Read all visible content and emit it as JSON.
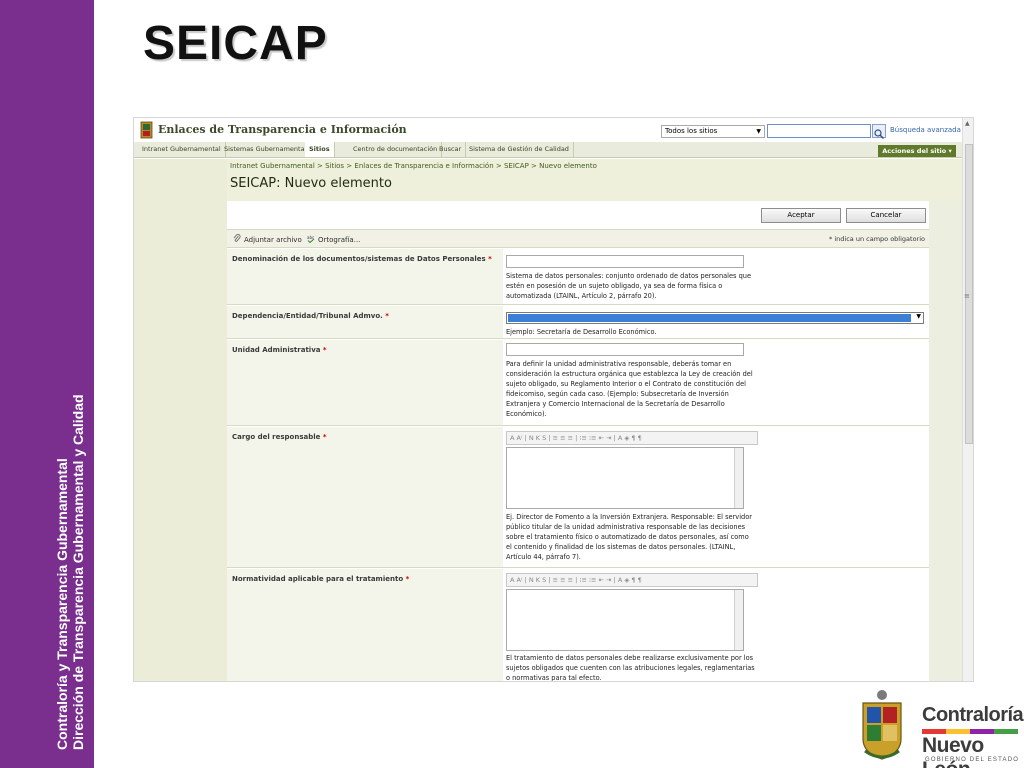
{
  "slide": {
    "title": "SEICAP",
    "side_line1": "Contraloría  y Transparencia Gubernamental",
    "side_line2": "Dirección de Transparencia Gubernamental y Calidad",
    "logo_text1": "Contraloría",
    "logo_text2": "Nuevo León",
    "logo_text3": "GOBIERNO DEL ESTADO",
    "band_color": "#7a2f8e"
  },
  "site": {
    "title": "Enlaces de Transparencia e Información",
    "scope": "Todos los sitios",
    "search_value": "",
    "advanced_search": "Búsqueda avanzada",
    "nav": [
      "Intranet Gubernamental",
      "Sistemas Gubernamentales ▾",
      "Sitios",
      "Centro de documentación",
      "Buscar",
      "Sistema de Gestión de Calidad"
    ],
    "site_actions": "Acciones del sitio ▾"
  },
  "page": {
    "breadcrumb": "Intranet Gubernamental > Sitios > Enlaces de Transparencia e Información > SEICAP > Nuevo elemento",
    "title": "SEICAP: Nuevo elemento"
  },
  "form": {
    "accept": "Aceptar",
    "cancel": "Cancelar",
    "attach": "Adjuntar archivo",
    "spelling": "Ortografía...",
    "required_note": "* indica un campo obligatorio",
    "rte_toolbar": "A  A⁽  |  N  K  S  |  ≡  ≡  ≡  |  ⁝≡  ⁝≡  ⇤  ⇥  |  A  ◈  ¶  ¶",
    "fields": [
      {
        "label": "Denominación de los documentos/sistemas de Datos Personales",
        "value": "",
        "help": "Sistema de datos personales: conjunto ordenado de datos personales que estén en posesión de un sujeto obligado, ya sea de forma física o automatizada (LTAINL, Artículo 2, párrafo 20)."
      },
      {
        "label": "Dependencia/Entidad/Tribunal Admvo.",
        "value": "",
        "help": "Ejemplo: Secretaría de Desarrollo Económico."
      },
      {
        "label": "Unidad Administrativa",
        "value": "",
        "help": "Para definir la unidad administrativa responsable, deberás tomar en consideración la estructura orgánica que establezca la Ley de creación del sujeto obligado, su Reglamento Interior o  el Contrato de constitución del fideicomiso, según cada caso. (Ejemplo: Subsecretaría de Inversión Extranjera y Comercio Internacional de la Secretaría de Desarrollo Económico)."
      },
      {
        "label": "Cargo del responsable",
        "value": "",
        "help": "Ej. Director de Fomento a la Inversión Extranjera. Responsable: El servidor público titular de la unidad administrativa responsable de las decisiones sobre el tratamiento físico o automatizado de datos personales, así como el contenido y finalidad de los sistemas de datos personales. (LTAINL, Artículo 44, párrafo 7)."
      },
      {
        "label": "Normatividad aplicable para el tratamiento",
        "value": "",
        "help": "El tratamiento de datos personales debe realizarse exclusivamente por los sujetos obligados que cuenten con las atribuciones legales, reglamentarias o normativas para tal efecto."
      }
    ]
  }
}
